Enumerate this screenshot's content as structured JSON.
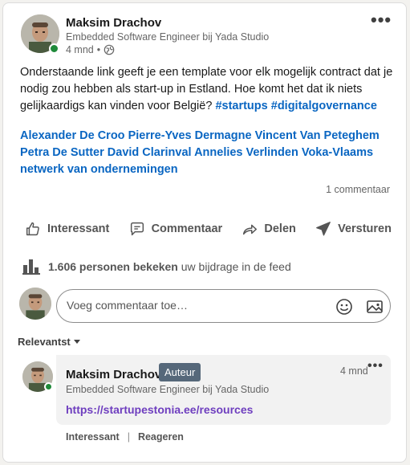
{
  "post": {
    "author_name": "Maksim Drachov",
    "author_headline": "Embedded Software Engineer bij Yada Studio",
    "time_ago": "4 mnd",
    "visibility_separator": "•",
    "more_label": "•••",
    "text": "Onderstaande link geeft je een template voor elk mogelijk contract dat je nodig zou hebben als start-up in Estland. Hoe komt het dat ik niets gelijkaardigs kan vinden voor België?",
    "hashtags": [
      "#startups",
      "#digitalgovernance"
    ],
    "mentions": [
      "Alexander De Croo",
      "Pierre-Yves Dermagne",
      "Vincent Van Peteghem",
      "Petra De Sutter",
      "David Clarinval",
      "Annelies Verlinden",
      "Voka-Vlaams netwerk van ondernemingen"
    ],
    "comment_count": "1 commentaar"
  },
  "actions": {
    "like": "Interessant",
    "comment": "Commentaar",
    "share": "Delen",
    "send": "Versturen"
  },
  "impressions": {
    "count": "1.606 personen bekeken",
    "suffix": "uw bijdrage in de feed"
  },
  "comment_box": {
    "placeholder": "Voeg commentaar toe…"
  },
  "sort": {
    "label": "Relevantst"
  },
  "comment": {
    "author_name": "Maksim Drachov",
    "badge": "Auteur",
    "author_headline": "Embedded Software Engineer bij Yada Studio",
    "time_ago": "4 mnd",
    "more_label": "•••",
    "link_text": "https://startupestonia.ee/resources",
    "like_label": "Interessant",
    "separator": "|",
    "reply_label": "Reageren"
  },
  "colors": {
    "link_blue": "#0a66c2",
    "visited_link": "#6e3ebf",
    "presence_green": "#1f8a3a",
    "badge_bg": "#56687a"
  }
}
